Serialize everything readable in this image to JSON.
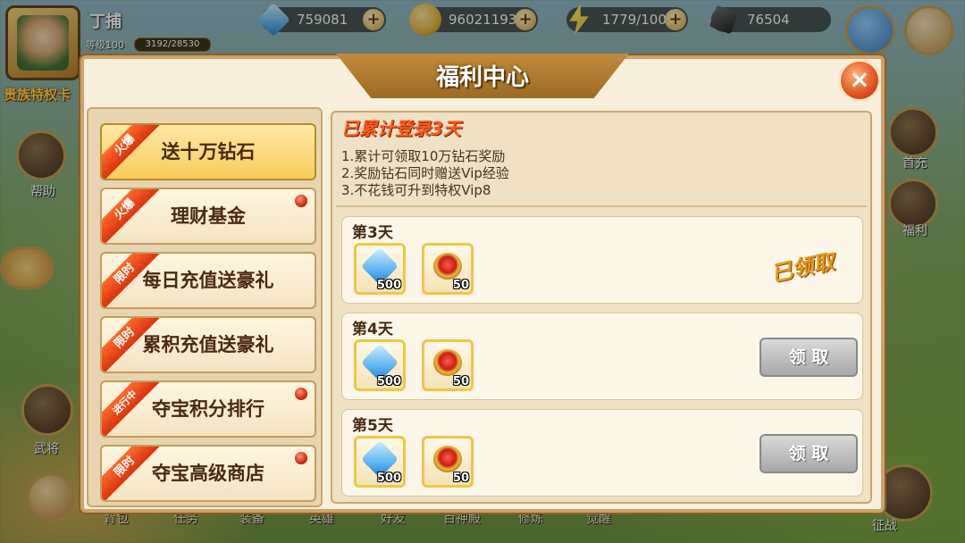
{
  "player": {
    "name": "丁捕",
    "level": "等级100",
    "exp": "3192/28530",
    "vip_banner": "贵族特权卡"
  },
  "resources": [
    {
      "name": "diamond",
      "value": "759081",
      "color": "#5eb4f0"
    },
    {
      "name": "coin",
      "value": "96021193",
      "color": "#e8b13a"
    },
    {
      "name": "energy",
      "value": "1779/100",
      "color": "#f4c21e"
    },
    {
      "name": "ore",
      "value": "76504",
      "color": "#2b2b2b"
    }
  ],
  "side_buttons": {
    "help": "帮助",
    "first_recharge": "首充",
    "welfare": "福利",
    "general": "武将",
    "campaign": "征战"
  },
  "bottom_tabs": [
    "背包",
    "任务",
    "装备",
    "英雄",
    "好友",
    "百神殿",
    "修炼",
    "觉醒"
  ],
  "dialog": {
    "title": "福利中心",
    "close": "×",
    "menu": [
      {
        "label": "送十万钻石",
        "tag": "火爆",
        "active": true,
        "dot": false
      },
      {
        "label": "理财基金",
        "tag": "火爆",
        "active": false,
        "dot": true
      },
      {
        "label": "每日充值送豪礼",
        "tag": "限时",
        "active": false,
        "dot": false
      },
      {
        "label": "累积充值送豪礼",
        "tag": "限时",
        "active": false,
        "dot": false
      },
      {
        "label": "夺宝积分排行",
        "tag": "进行中",
        "active": false,
        "dot": true
      },
      {
        "label": "夺宝高级商店",
        "tag": "限时",
        "active": false,
        "dot": true
      }
    ],
    "login_title": "已累计登录3天",
    "rules": [
      "1.累计可领取10万钻石奖励",
      "2.奖励钻石同时赠送Vip经验",
      "3.不花钱可升到特权Vip8"
    ],
    "days": [
      {
        "label": "第3天",
        "rewards": [
          {
            "icon": "diamond-icon",
            "qty": "500"
          },
          {
            "icon": "ring-icon",
            "qty": "50"
          }
        ],
        "status": "已领取"
      },
      {
        "label": "第4天",
        "rewards": [
          {
            "icon": "diamond-icon",
            "qty": "500"
          },
          {
            "icon": "ring-icon",
            "qty": "50"
          }
        ],
        "button": "领 取"
      },
      {
        "label": "第5天",
        "rewards": [
          {
            "icon": "diamond-icon",
            "qty": "500"
          },
          {
            "icon": "ring-icon",
            "qty": "50"
          }
        ],
        "button": "领 取"
      }
    ]
  }
}
